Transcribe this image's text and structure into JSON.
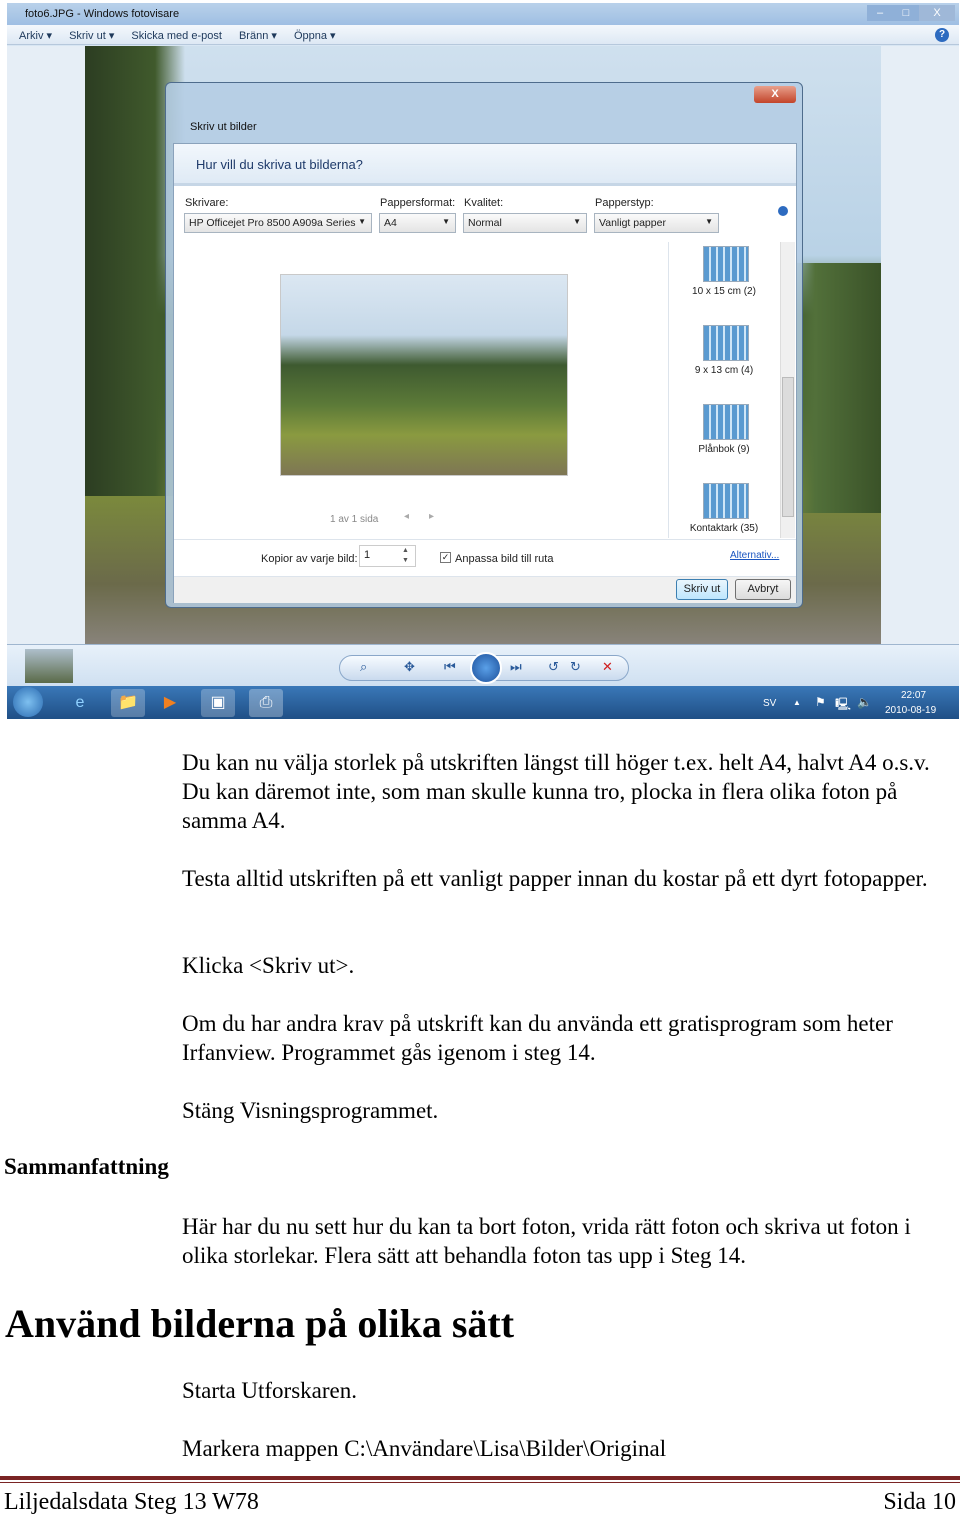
{
  "window": {
    "title": "foto6.JPG - Windows fotovisare",
    "menu": [
      "Arkiv ▾",
      "Skriv ut ▾",
      "Skicka med e-post",
      "Bränn ▾",
      "Öppna ▾"
    ],
    "minimize": "–",
    "maximize": "□",
    "close": "X",
    "help": "?"
  },
  "dialog": {
    "title": "Skriv ut bilder",
    "close": "X",
    "heading": "Hur vill du skriva ut bilderna?",
    "printer_label": "Skrivare:",
    "printer": "HP Officejet Pro 8500 A909a Series",
    "paper_size_label": "Pappersformat:",
    "paper_size": "A4",
    "quality_label": "Kvalitet:",
    "quality": "Normal",
    "paper_type_label": "Papperstyp:",
    "paper_type": "Vanligt papper",
    "page_info": "1 av 1 sida",
    "layouts": [
      "10 x 15 cm (2)",
      "9 x 13 cm (4)",
      "Plånbok (9)",
      "Kontaktark (35)"
    ],
    "copies_label": "Kopior av varje bild:",
    "copies": "1",
    "fit_label": "Anpassa bild till ruta",
    "fit_checked": true,
    "options_link": "Alternativ...",
    "print_button": "Skriv ut",
    "cancel_button": "Avbryt"
  },
  "taskbar": {
    "lang": "SV",
    "time": "22:07",
    "date": "2010-08-19"
  },
  "doc": {
    "paragraphs": [
      "Du kan nu välja storlek på utskriften längst till höger t.ex. helt A4, halvt A4 o.s.v. Du kan däremot inte, som man skulle kunna tro, plocka in flera olika foton på samma A4.",
      "Testa alltid utskriften på ett vanligt papper innan du kostar på ett dyrt fotopapper.",
      "Klicka <Skriv ut>.",
      "Om du har andra krav på utskrift kan du använda ett gratisprogram som heter Irfanview. Programmet gås igenom i steg 14.",
      "Stäng Visningsprogrammet.",
      "Här har du nu sett hur du kan ta bort foton, vrida rätt foton och skriva ut foton i olika storlekar. Flera sätt att behandla foton tas upp i Steg 14.",
      "Starta Utforskaren.",
      "Markera mappen C:\\Användare\\Lisa\\Bilder\\Original"
    ],
    "side_heading": "Sammanfattning",
    "heading": "Använd bilderna på olika sätt"
  },
  "footer": {
    "left": "Liljedalsdata Steg 13 W78",
    "right": "Sida 10"
  },
  "colors": {
    "footer_rule": "#7a2424",
    "taskbar": "#2a5f9a"
  }
}
